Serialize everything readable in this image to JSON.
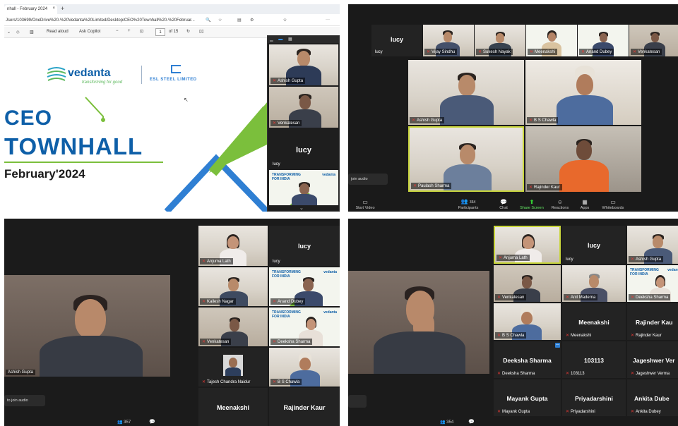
{
  "q1": {
    "tab_title": "nhall - February 2024",
    "address": "Jsers/103699/OneDrive%20-%20Vedanta%20Limited/Desktop/CEO%20Townhall%20-%20Februar...",
    "read_aloud": "Read aloud",
    "ask_copilot": "Ask Copilot",
    "page_num": "1",
    "page_total": "of 15",
    "logo_name": "vedanta",
    "logo_tag": "transforming for good",
    "esl": "ESL STEEL LIMITED",
    "title1": "CEO",
    "title2": "TOWNHALL",
    "title3": "February'2024",
    "panel": {
      "tiles": [
        {
          "name": "Ashish Gupta"
        },
        {
          "name": "Venkatesan"
        },
        {
          "name": "lucy",
          "big": "lucy"
        }
      ],
      "transform_text": "TRANSFORMING\nFOR INDIA",
      "transform_logo": "vedanta"
    }
  },
  "q2": {
    "top": [
      {
        "name": "lucy",
        "big": "lucy"
      },
      {
        "name": "Vijay Sindhu"
      },
      {
        "name": "Sukesh Nayak"
      },
      {
        "name": "Meenakshi"
      },
      {
        "name": "Anand Dubey"
      },
      {
        "name": "Venkatesan"
      }
    ],
    "main": [
      {
        "name": "Ashish Gupta"
      },
      {
        "name": "B S Chawla"
      },
      {
        "name": "Paulash Sharma"
      },
      {
        "name": "Rajinder Kaur"
      }
    ],
    "join_audio": "join audio",
    "toolbar": [
      {
        "icon": "video-icon",
        "label": "Start Video",
        "glyph": "▶"
      },
      {
        "icon": "participants-icon",
        "label": "Participants",
        "glyph": "👥",
        "count": "364"
      },
      {
        "icon": "chat-icon",
        "label": "Chat",
        "glyph": "💬"
      },
      {
        "icon": "share-icon",
        "label": "Share Screen",
        "glyph": "⬆"
      },
      {
        "icon": "reactions-icon",
        "label": "Reactions",
        "glyph": "☺"
      },
      {
        "icon": "apps-icon",
        "label": "Apps",
        "glyph": "▦"
      },
      {
        "icon": "whiteboards-icon",
        "label": "Whiteboards",
        "glyph": "▭"
      }
    ]
  },
  "q3": {
    "speaker": "Ashish Gupta",
    "join_audio": "to join audio",
    "count": "357",
    "grid": [
      {
        "name": "Anjuma Lath"
      },
      {
        "name": "lucy",
        "big": "lucy"
      },
      {
        "name": "Kailesh Nagar"
      },
      {
        "name": "Anand Dubey"
      },
      {
        "name": "Venkatesan"
      },
      {
        "name": "Deeksha Sharma"
      },
      {
        "name": "Tajesh Chandra Naidur"
      },
      {
        "name": "B S Chawla"
      },
      {
        "name": "Meenakshi",
        "big": "Meenakshi"
      },
      {
        "name": "Rajinder Kaur",
        "big": "Rajinder Kaur"
      }
    ]
  },
  "q4": {
    "count": "354",
    "grid": [
      {
        "name": "Anjuma Lath"
      },
      {
        "name": "lucy",
        "big": "lucy"
      },
      {
        "name": "Ashish Gupta"
      },
      {
        "name": "Venkatesan"
      },
      {
        "name": "Anil Maderna"
      },
      {
        "name": "Deeksha Sharma"
      },
      {
        "name": "B S Chawla"
      },
      {
        "name": "Meenakshi",
        "big": "Meenakshi"
      },
      {
        "name": "Rajinder Kaur",
        "big": "Rajinder Kau"
      },
      {
        "name": "Deeksha Sharma",
        "big": "Deeksha Sharma"
      },
      {
        "name": "103113",
        "big": "103113"
      },
      {
        "name": "Jageshwer Verma",
        "big": "Jageshwer Ver"
      },
      {
        "name": "Mayank Gupta",
        "big": "Mayank Gupta"
      },
      {
        "name": "Priyadarshini",
        "big": "Priyadarshini"
      },
      {
        "name": "Ankita Dubey",
        "big": "Ankita Dube"
      }
    ]
  }
}
